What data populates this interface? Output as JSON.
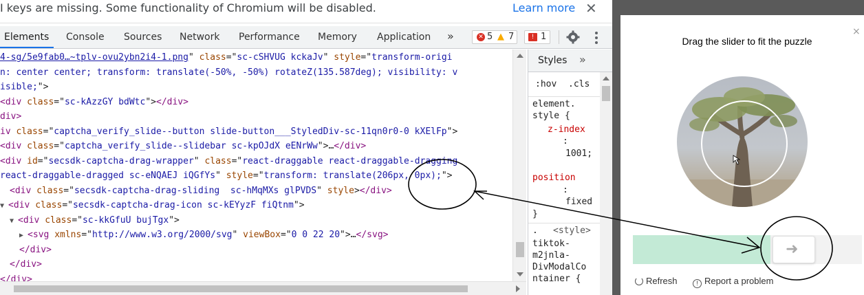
{
  "infobar": {
    "message": "I keys are missing. Some functionality of Chromium will be disabled.",
    "learn_more": "Learn more",
    "close_glyph": "✕"
  },
  "devtools": {
    "tabs": [
      "Elements",
      "Console",
      "Sources",
      "Network",
      "Performance",
      "Memory",
      "Application"
    ],
    "more_tabs_glyph": "»",
    "errors_count": "5",
    "warnings_count": "7",
    "issues_count": "1",
    "settings_icon": "gear-icon",
    "menu_icon": "kebab-menu-icon"
  },
  "elements_lines": [
    {
      "indent": 0,
      "tri": "",
      "parts": [
        [
          "lnk",
          "4-sg/5e9fab0…~tplv-ovu2ybn2i4-1.png"
        ],
        [
          "txt",
          "\" "
        ],
        [
          "attr",
          "class"
        ],
        [
          "txt",
          "=\""
        ],
        [
          "val",
          "sc-cSHVUG kckaJv"
        ],
        [
          "txt",
          "\" "
        ],
        [
          "attr",
          "style"
        ],
        [
          "txt",
          "=\""
        ],
        [
          "val",
          "transform-origi"
        ]
      ]
    },
    {
      "indent": 0,
      "tri": "",
      "parts": [
        [
          "val",
          "n: center center; transform: translate(-50%, -50%) rotateZ(135.587deg); visibility: v"
        ]
      ]
    },
    {
      "indent": 0,
      "tri": "",
      "parts": [
        [
          "val",
          "isible;"
        ],
        [
          "txt",
          "\">"
        ]
      ]
    },
    {
      "indent": 0,
      "tri": "",
      "parts": [
        [
          "tag",
          "<div "
        ],
        [
          "attr",
          "class"
        ],
        [
          "txt",
          "=\""
        ],
        [
          "val",
          "sc-kAzzGY bdWtc"
        ],
        [
          "txt",
          "\">"
        ],
        [
          "tag",
          "</div>"
        ]
      ]
    },
    {
      "indent": 0,
      "tri": "",
      "parts": [
        [
          "tag",
          "div>"
        ]
      ]
    },
    {
      "indent": 0,
      "tri": "",
      "parts": [
        [
          "tag",
          "iv "
        ],
        [
          "attr",
          "class"
        ],
        [
          "txt",
          "=\""
        ],
        [
          "val",
          "captcha_verify_slide--button slide-button___StyledDiv-sc-11qn0r0-0 kXElFp"
        ],
        [
          "txt",
          "\">"
        ]
      ]
    },
    {
      "indent": 0,
      "tri": "",
      "parts": [
        [
          "tag",
          "<div "
        ],
        [
          "attr",
          "class"
        ],
        [
          "txt",
          "=\""
        ],
        [
          "val",
          "captcha_verify_slide--slidebar sc-kpOJdX eENrWw"
        ],
        [
          "txt",
          "\">…"
        ],
        [
          "tag",
          "</div>"
        ]
      ]
    },
    {
      "indent": 0,
      "tri": "",
      "parts": [
        [
          "tag",
          "<div "
        ],
        [
          "attr",
          "id"
        ],
        [
          "txt",
          "=\""
        ],
        [
          "val",
          "secsdk-captcha-drag-wrapper"
        ],
        [
          "txt",
          "\" "
        ],
        [
          "attr",
          "class"
        ],
        [
          "txt",
          "=\""
        ],
        [
          "val",
          "react-draggable react-draggable-dragging"
        ]
      ]
    },
    {
      "indent": 0,
      "tri": "",
      "parts": [
        [
          "val",
          "react-draggable-dragged sc-eNQAEJ iQGfYs"
        ],
        [
          "txt",
          "\" "
        ],
        [
          "attr",
          "style"
        ],
        [
          "txt",
          "=\""
        ],
        [
          "val",
          "transform: translate(206px, 0px);"
        ],
        [
          "txt",
          "\">"
        ]
      ]
    },
    {
      "indent": 1,
      "tri": "",
      "parts": [
        [
          "tag",
          "<div "
        ],
        [
          "attr",
          "class"
        ],
        [
          "txt",
          "=\""
        ],
        [
          "val",
          "secsdk-captcha-drag-sliding  sc-hMqMXs glPVDS"
        ],
        [
          "txt",
          "\" "
        ],
        [
          "attr",
          "style"
        ],
        [
          "txt",
          ">"
        ],
        [
          "tag",
          "</div>"
        ]
      ]
    },
    {
      "indent": 0,
      "tri": "▼",
      "parts": [
        [
          "tag",
          "<div "
        ],
        [
          "attr",
          "class"
        ],
        [
          "txt",
          "=\""
        ],
        [
          "val",
          "secsdk-captcha-drag-icon sc-kEYyzF fiQtnm"
        ],
        [
          "txt",
          "\">"
        ]
      ]
    },
    {
      "indent": 1,
      "tri": "▼",
      "parts": [
        [
          "tag",
          "<div "
        ],
        [
          "attr",
          "class"
        ],
        [
          "txt",
          "=\""
        ],
        [
          "val",
          "sc-kkGfuU bujTgx"
        ],
        [
          "txt",
          "\">"
        ]
      ]
    },
    {
      "indent": 2,
      "tri": "▶",
      "parts": [
        [
          "tag",
          "<svg "
        ],
        [
          "attr",
          "xmlns"
        ],
        [
          "txt",
          "=\""
        ],
        [
          "val",
          "http://www.w3.org/2000/svg"
        ],
        [
          "txt",
          "\" "
        ],
        [
          "attr",
          "viewBox"
        ],
        [
          "txt",
          "=\""
        ],
        [
          "val",
          "0 0 22 20"
        ],
        [
          "txt",
          "\">…"
        ],
        [
          "tag",
          "</svg>"
        ]
      ]
    },
    {
      "indent": 2,
      "tri": "",
      "parts": [
        [
          "tag",
          "</div>"
        ]
      ]
    },
    {
      "indent": 1,
      "tri": "",
      "parts": [
        [
          "tag",
          "</div>"
        ]
      ]
    },
    {
      "indent": 0,
      "tri": "",
      "parts": [
        [
          "tag",
          "</div>"
        ]
      ]
    }
  ],
  "styles_panel": {
    "tab_label": "Styles",
    "more_glyph": "»",
    "filter_hov": ":hov",
    "filter_cls": ".cls",
    "element_style": "element.\nstyle {",
    "prop1_name": "z-index",
    "prop1_value": "1001;",
    "prop2_name": "position",
    "prop2_value": "fixed",
    "close_brace": "}",
    "rule2_prefix": ".",
    "rule2_source": "<style>",
    "rule2_selector": "tiktok-\nm2jnla-\nDivModalCo\nntainer {"
  },
  "captcha": {
    "title": "Drag the slider to fit the puzzle",
    "close_glyph": "×",
    "refresh_label": "Refresh",
    "report_label": "Report a problem",
    "refresh_icon": "refresh-icon",
    "report_icon": "info-circle-icon",
    "slider_progress_fraction": 0.6,
    "slider_arrow_glyph": "➜"
  },
  "colors": {
    "accent_blue": "#1a73e8",
    "error_red": "#d93025",
    "warning_amber": "#f9ab00",
    "slider_fill": "#c3ead6"
  }
}
